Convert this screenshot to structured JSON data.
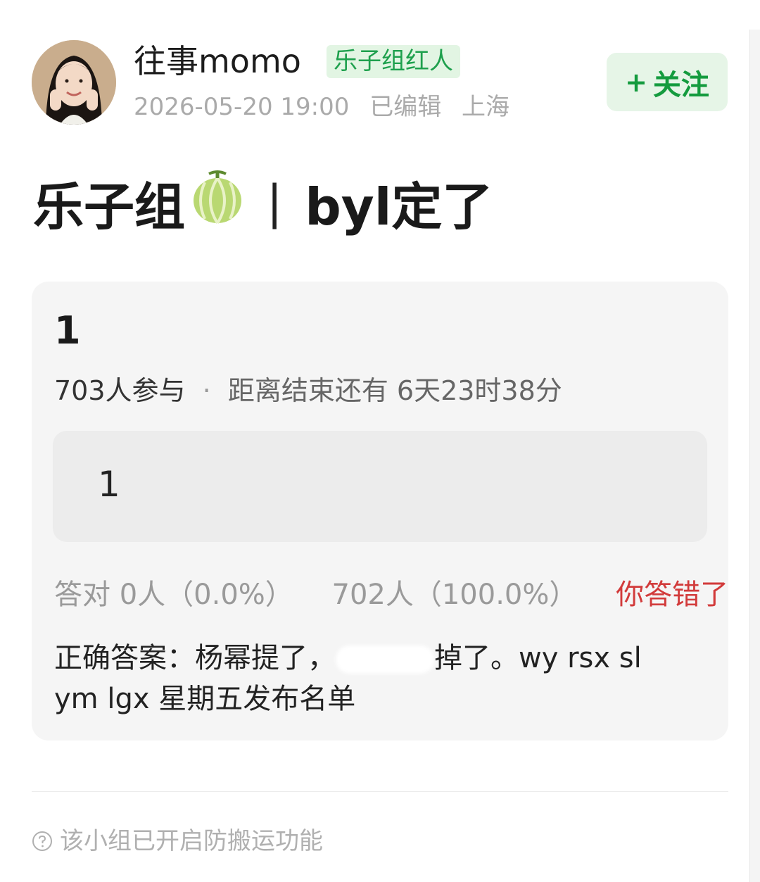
{
  "author": {
    "name": "往事momo",
    "badge": "乐子组红人",
    "date": "2026-05-20 19:00",
    "edited": "已编辑",
    "location": "上海"
  },
  "follow": {
    "plus": "+",
    "label": "关注"
  },
  "post": {
    "title_main": "乐子组",
    "title_icon": "melon-icon",
    "title_sep": "|",
    "title_suffix": "byl定了"
  },
  "quiz": {
    "title": "1",
    "participants": "703人参与",
    "dot": "·",
    "remaining": "距离结束还有 6天23时38分",
    "option_label": "1",
    "correct_stat": "答对 0人（0.0%）",
    "option_stat": "702人（100.0%）",
    "result": "你答错了",
    "answer_prefix": "正确答案：杨幂提了，",
    "answer_suffix": "掉了。wy rsx sl ym lgx 星期五发布名单"
  },
  "footer": {
    "notice": "该小组已开启防搬运功能",
    "icon": "question-circle-icon"
  },
  "colors": {
    "accent_green": "#1ea04d",
    "follow_bg": "#e6f5e7",
    "wrong_red": "#d23b3b",
    "card_bg": "#f5f5f5"
  }
}
